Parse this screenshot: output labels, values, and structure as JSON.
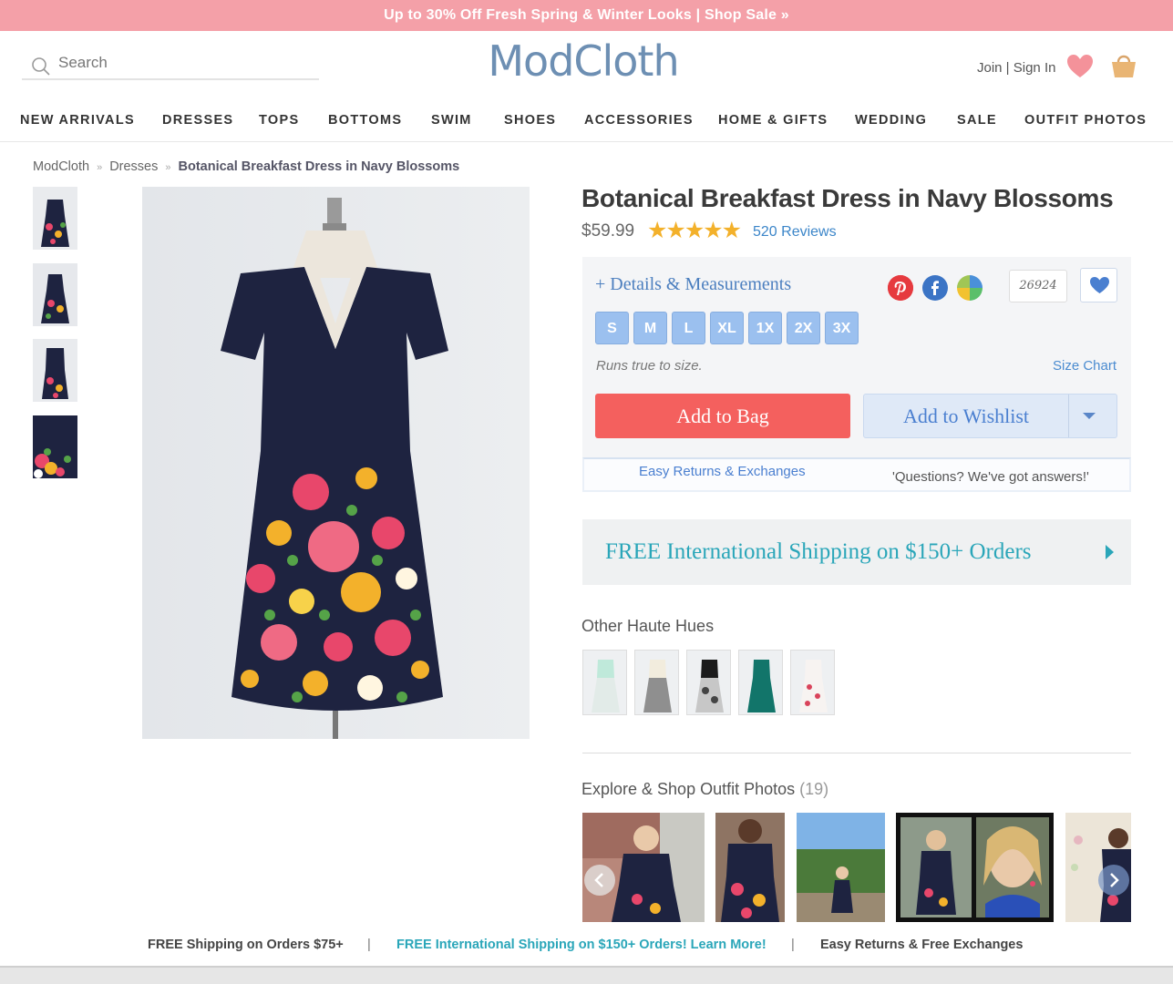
{
  "promo": {
    "text": "Up to 30% Off Fresh Spring & Winter Looks | Shop Sale »"
  },
  "header": {
    "search_placeholder": "Search",
    "logo": "ModCloth",
    "account": "Join | Sign In",
    "icons": [
      "search-icon",
      "heart-icon",
      "shopping-bag-icon"
    ]
  },
  "nav": [
    "NEW ARRIVALS",
    "DRESSES",
    "TOPS",
    "BOTTOMS",
    "SWIM",
    "SHOES",
    "ACCESSORIES",
    "HOME & GIFTS",
    "WEDDING",
    "SALE",
    "OUTFIT PHOTOS"
  ],
  "breadcrumb": {
    "items": [
      "ModCloth",
      "Dresses",
      "Botanical Breakfast Dress in Navy Blossoms"
    ],
    "sep": "»"
  },
  "product": {
    "title": "Botanical Breakfast Dress in Navy Blossoms",
    "price": "$59.99",
    "stars": "★★★★★",
    "rating": 5,
    "reviews": "520 Reviews",
    "details": "+ Details & Measurements",
    "wishlist_count": "26924",
    "sizes": [
      "S",
      "M",
      "L",
      "XL",
      "1X",
      "2X",
      "3X"
    ],
    "fit_note": "Runs true to size.",
    "size_chart": "Size Chart",
    "add_to_bag": "Add to Bag",
    "add_to_wishlist": "Add to Wishlist",
    "returns": "Easy Returns & Exchanges",
    "questions": "'Questions? We've got answers!'",
    "colors": {
      "dress_top": "#1e2340",
      "accent_red": "#f4605e",
      "size_blue": "#9bc0ef",
      "link_blue": "#4a7fd0",
      "teal": "#2aa6b9"
    }
  },
  "shipping_banner": "FREE International Shipping on $150+ Orders",
  "hues": {
    "heading": "Other Haute Hues",
    "swatches": [
      "#bfe9da",
      "#f2ecdd",
      "#1b1b1b",
      "#12756a",
      "#f7f3f1"
    ]
  },
  "outfits": {
    "heading": "Explore & Shop Outfit Photos",
    "count": "(19)"
  },
  "footer": {
    "left": "FREE Shipping on Orders $75+",
    "sep": "|",
    "middle": "FREE International Shipping on $150+ Orders! Learn More!",
    "right": "Easy Returns & Free Exchanges"
  }
}
